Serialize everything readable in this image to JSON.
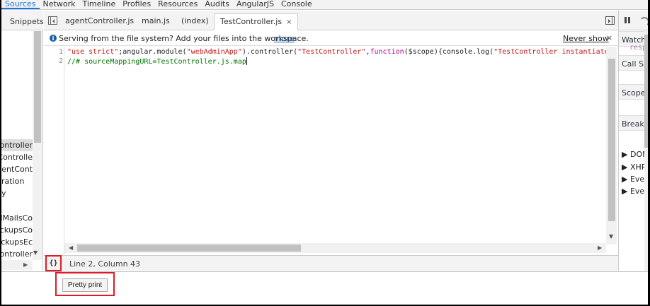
{
  "panel_tabs": [
    "Sources",
    "Network",
    "Timeline",
    "Profiles",
    "Resources",
    "Audits",
    "AngularJS",
    "Console"
  ],
  "navigator": {
    "header": "Snippets",
    "items": [
      "ontroller",
      "Controlle",
      "gentCont",
      "ration",
      "y",
      "",
      "dMailsCo",
      "ackupsCo",
      "ackupsEc",
      "ontroller."
    ]
  },
  "editor_tabs": [
    {
      "label": "agentController.js"
    },
    {
      "label": "main.js"
    },
    {
      "label": "(index)"
    },
    {
      "label": "TestController.js",
      "close": "×"
    }
  ],
  "infobar": {
    "text": "Serving from the file system? Add your files into the workspace.",
    "more": "more",
    "never_show": "Never show",
    "close": "×"
  },
  "code": {
    "line_numbers": [
      "1",
      "2"
    ],
    "line1": {
      "t1": "\"use strict\"",
      "t2": ";angular.module(",
      "t3": "\"webAdminApp\"",
      "t4": ").controller(",
      "t5": "\"TestController\"",
      "t6": ",",
      "t7": "function",
      "t8": "($scope){console.log(",
      "t9": "\"TestController instantiated"
    },
    "line2": "//# sourceMappingURL=TestController.js.map"
  },
  "statusbar": {
    "pretty_icon": "{}",
    "cursor_position": "Line 2, Column 43"
  },
  "debugger": {
    "sections": [
      "Watch",
      "Call S",
      "Scope",
      "Break"
    ],
    "watch_value": "respo",
    "items": [
      "DOM",
      "XHR &",
      "Event",
      "Event"
    ]
  },
  "bottom": {
    "pretty_print_label": "Pretty print"
  },
  "colors": {
    "highlight_red": "#e01b24",
    "string": "#c41a16",
    "keyword": "#aa0d91",
    "comment": "#007400",
    "link": "#1a5ea8"
  },
  "icons": [
    "info-icon",
    "toggle-navigator-icon",
    "toggle-debugger-icon",
    "close-icon",
    "pause-icon",
    "step-over-icon",
    "pretty-print-icon"
  ]
}
